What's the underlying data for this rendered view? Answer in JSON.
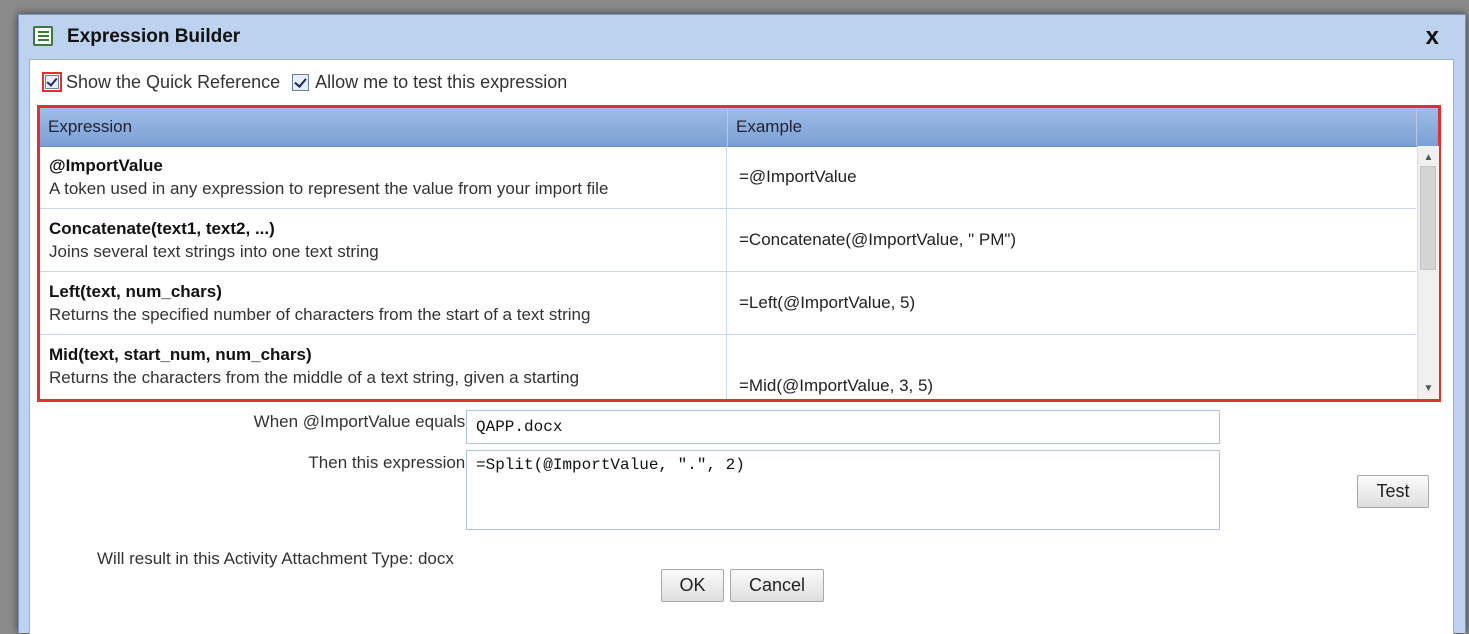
{
  "dialog": {
    "title": "Expression Builder",
    "close_label": "x"
  },
  "options": {
    "show_quick_reference": {
      "label": "Show the Quick Reference",
      "checked": true
    },
    "allow_test": {
      "label": "Allow me to test this expression",
      "checked": true
    }
  },
  "grid": {
    "columns": [
      "Expression",
      "Example"
    ],
    "rows": [
      {
        "name": "@ImportValue",
        "description": "A token used in any expression to represent the value from your import file",
        "example": "=@ImportValue"
      },
      {
        "name": "Concatenate(text1, text2, ...)",
        "description": "Joins several text strings into one text string",
        "example": "=Concatenate(@ImportValue, \" PM\")"
      },
      {
        "name": "Left(text, num_chars)",
        "description": "Returns the specified number of characters from the start of a text string",
        "example": "=Left(@ImportValue, 5)"
      },
      {
        "name": "Mid(text, start_num, num_chars)",
        "description": "Returns the characters from the middle of a text string, given a starting",
        "example": "=Mid(@ImportValue, 3, 5)"
      }
    ]
  },
  "test": {
    "when_label": "When @ImportValue equals:",
    "when_value": "QAPP.docx",
    "then_label": "Then this expression:",
    "then_value": "=Split(@ImportValue, \".\", 2)",
    "test_button": "Test",
    "result_label": "Will result in this Activity Attachment Type:",
    "result_value": "docx"
  },
  "buttons": {
    "ok": "OK",
    "cancel": "Cancel"
  },
  "colors": {
    "highlight_border": "#e03030",
    "header_blue": "#7ba0d6",
    "frame_blue": "#bcd2ef"
  }
}
